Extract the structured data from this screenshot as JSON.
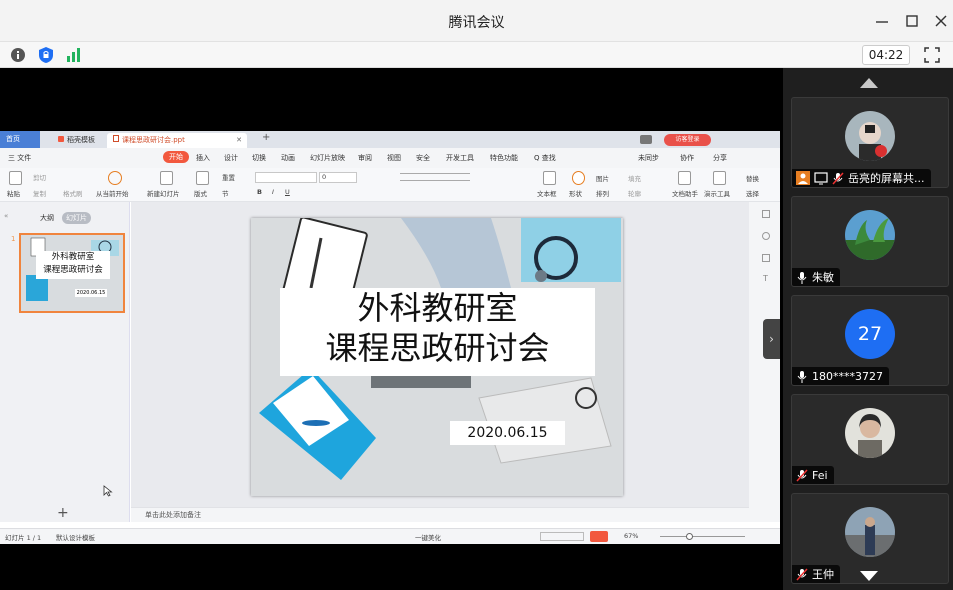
{
  "window": {
    "title": "腾讯会议"
  },
  "meeting_bar": {
    "timer": "04:22"
  },
  "wps": {
    "tabs": [
      "首页",
      "稻壳模板",
      "课程思政研讨会.ppt"
    ],
    "login_label": "访客登录",
    "menu": [
      "三 文件",
      "开始",
      "插入",
      "设计",
      "切换",
      "动画",
      "幻灯片放映",
      "审阅",
      "视图",
      "安全",
      "开发工具",
      "特色功能",
      "Q 查找",
      "未同步",
      "协作",
      "分享"
    ],
    "ribbon": {
      "paste": "粘贴",
      "cut": "剪切",
      "copy": "复制",
      "format_painter": "格式刷",
      "from_start": "从当前开始",
      "new_slide": "新建幻灯片",
      "layout": "版式",
      "section": "节",
      "reset": "重置",
      "font_size": "0",
      "textbox": "文本框",
      "shape": "形状",
      "picture": "图片",
      "arrange": "排列",
      "fill": "填充",
      "outline": "轮廓",
      "doc_helper": "文档助手",
      "present_tool": "演示工具",
      "replace": "替换",
      "select": "选择"
    },
    "left_panel": {
      "tab_outline": "大纲",
      "tab_slides": "幻灯片",
      "slide_num": "1",
      "add": "+"
    },
    "thumb": {
      "line1": "外科教研室",
      "line2": "课程思政研讨会",
      "date": "2020.06.15"
    },
    "slide": {
      "title_line1": "外科教研室",
      "title_line2": "课程思政研讨会",
      "date": "2020.06.15"
    },
    "notes_placeholder": "单击此处添加备注",
    "status": {
      "slide_count": "幻灯片 1 / 1",
      "theme": "默认设计模板",
      "beautify": "一键美化",
      "zoom": "67%"
    }
  },
  "participants": [
    {
      "name": "岳亮的屏幕共...",
      "avatar": "photo-person"
    },
    {
      "name": "朱敏",
      "avatar": "photo-palm"
    },
    {
      "name": "180****3727",
      "avatar_text": "27"
    },
    {
      "name": "Fei",
      "avatar": "photo-woman"
    },
    {
      "name": "王仲",
      "avatar": "photo-street"
    }
  ]
}
